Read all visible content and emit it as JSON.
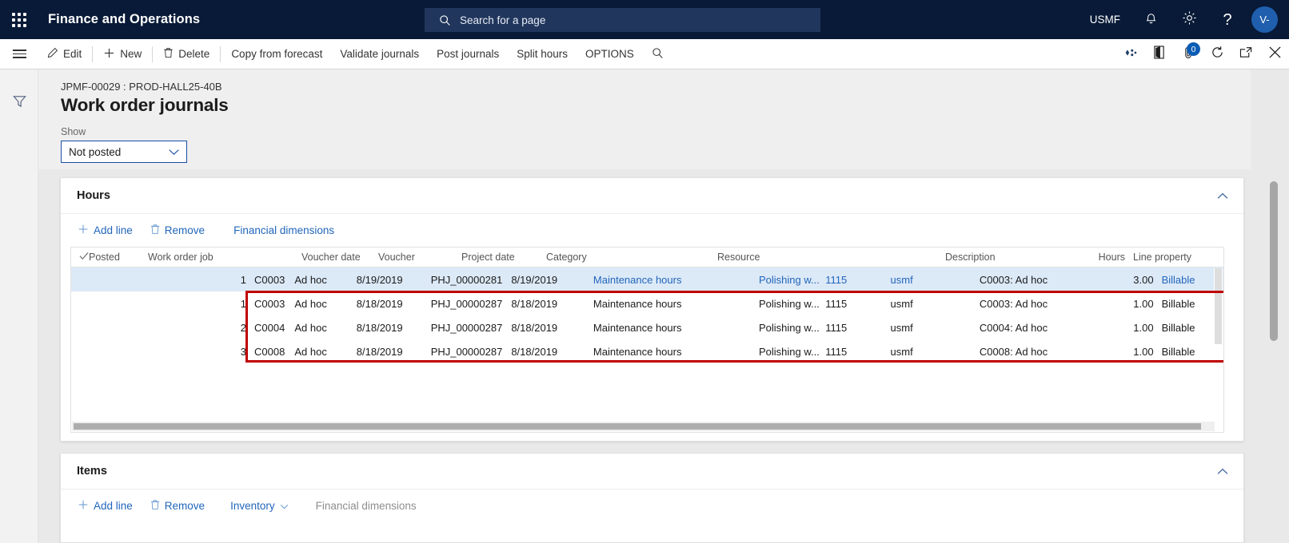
{
  "topnav": {
    "app_title": "Finance and Operations",
    "waffle_icon": "app-launcher-icon",
    "search": {
      "placeholder": "Search for a page",
      "icon": "search-icon"
    },
    "company": "USMF",
    "notifications_icon": "bell-icon",
    "settings_icon": "gear-icon",
    "help_icon": "question-mark-icon",
    "avatar_initials": "V-",
    "brand_bg": "#081a37",
    "search_bg": "#21365c",
    "avatar_bg": "#1f5fae"
  },
  "toolbar": {
    "menu_icon": "hamburger-menu-icon",
    "items": [
      {
        "label": "Edit",
        "icon": "pencil-icon"
      },
      {
        "label": "New",
        "icon": "plus-icon"
      },
      {
        "label": "Delete",
        "icon": "trash-icon"
      },
      {
        "label": "Copy from forecast",
        "icon": ""
      },
      {
        "label": "Validate journals",
        "icon": ""
      },
      {
        "label": "Post journals",
        "icon": ""
      },
      {
        "label": "Split hours",
        "icon": ""
      },
      {
        "label": "OPTIONS",
        "icon": ""
      }
    ],
    "search_icon": "search-icon",
    "right_icons": [
      {
        "name": "share-icon",
        "badge": ""
      },
      {
        "name": "office-app-icon",
        "badge": ""
      },
      {
        "name": "attachment-icon",
        "badge": "0"
      },
      {
        "name": "refresh-icon",
        "badge": ""
      },
      {
        "name": "open-in-new-window-icon",
        "badge": ""
      },
      {
        "name": "close-icon",
        "badge": ""
      }
    ],
    "badge_color": "#0b5cb5"
  },
  "leftrail": {
    "filter_icon": "filter-funnel-icon"
  },
  "page": {
    "breadcrumb": "JPMF-00029 : PROD-HALL25-40B",
    "title": "Work order journals",
    "show_label": "Show",
    "show_value": "Not posted",
    "dropdown_icon": "chevron-down-icon"
  },
  "hours_section": {
    "title": "Hours",
    "collapse_icon": "chevron-up-icon",
    "toolbar": [
      {
        "label": "Add line",
        "icon": "plus-icon",
        "state": "enabled"
      },
      {
        "label": "Remove",
        "icon": "trash-icon",
        "state": "enabled"
      },
      {
        "label": "Financial dimensions",
        "icon": "",
        "state": "enabled"
      }
    ],
    "columns": [
      "",
      "Posted",
      "Work order job",
      "",
      "Voucher date",
      "Voucher",
      "Project date",
      "Category",
      "Resource",
      "",
      "",
      "Description",
      "Hours",
      "Line property"
    ],
    "check_icon": "checkmark-icon",
    "rows": [
      {
        "line": "1",
        "job": "C0003",
        "type": "Ad hoc",
        "voucher_date": "8/19/2019",
        "voucher": "PHJ_00000281",
        "project_date": "8/19/2019",
        "category": "Maintenance hours",
        "resource": "Polishing w...",
        "resource_num": "1115",
        "entity": "usmf",
        "description": "C0003: Ad hoc",
        "hours": "3.00",
        "line_property": "Billable",
        "selected": true
      },
      {
        "line": "1",
        "job": "C0003",
        "type": "Ad hoc",
        "voucher_date": "8/18/2019",
        "voucher": "PHJ_00000287",
        "project_date": "8/18/2019",
        "category": "Maintenance hours",
        "resource": "Polishing w...",
        "resource_num": "1115",
        "entity": "usmf",
        "description": "C0003: Ad hoc",
        "hours": "1.00",
        "line_property": "Billable",
        "selected": false
      },
      {
        "line": "2",
        "job": "C0004",
        "type": "Ad hoc",
        "voucher_date": "8/18/2019",
        "voucher": "PHJ_00000287",
        "project_date": "8/18/2019",
        "category": "Maintenance hours",
        "resource": "Polishing w...",
        "resource_num": "1115",
        "entity": "usmf",
        "description": "C0004: Ad hoc",
        "hours": "1.00",
        "line_property": "Billable",
        "selected": false
      },
      {
        "line": "3",
        "job": "C0008",
        "type": "Ad hoc",
        "voucher_date": "8/18/2019",
        "voucher": "PHJ_00000287",
        "project_date": "8/18/2019",
        "category": "Maintenance hours",
        "resource": "Polishing w...",
        "resource_num": "1115",
        "entity": "usmf",
        "description": "C0008: Ad hoc",
        "hours": "1.00",
        "line_property": "Billable",
        "selected": false
      }
    ],
    "annotation": {
      "type": "highlight-rectangle",
      "color": "#c00000"
    }
  },
  "items_section": {
    "title": "Items",
    "collapse_icon": "chevron-up-icon",
    "toolbar": [
      {
        "label": "Add line",
        "icon": "plus-icon",
        "state": "enabled"
      },
      {
        "label": "Remove",
        "icon": "trash-icon",
        "state": "enabled"
      },
      {
        "label": "Inventory",
        "icon": "chevron-down-icon",
        "state": "enabled"
      },
      {
        "label": "Financial dimensions",
        "icon": "",
        "state": "disabled"
      }
    ]
  }
}
